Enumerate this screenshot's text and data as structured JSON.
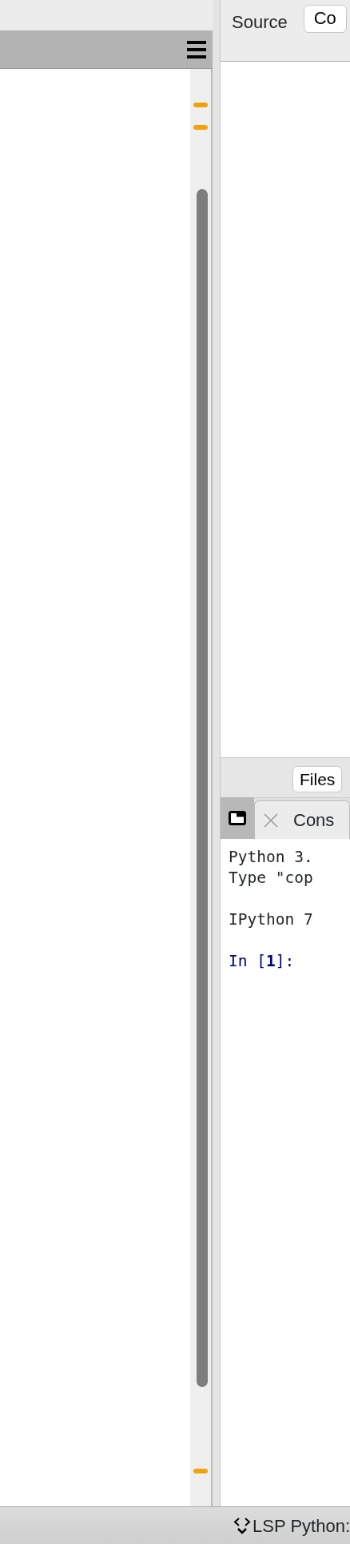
{
  "editor_toolbar": {
    "label": "Source",
    "button": "Co"
  },
  "bottom_tabs": [
    {
      "label": "Files"
    }
  ],
  "console": {
    "tab": "Cons",
    "lines": [
      {
        "kind": "output",
        "text": "Python 3."
      },
      {
        "kind": "output",
        "text": "Type \"cop"
      },
      {
        "kind": "banner",
        "text": "IPython 7"
      },
      {
        "kind": "prompt",
        "text": "In [**1**]:"
      }
    ]
  },
  "status_bar": {
    "lsp": "LSP Python:"
  }
}
